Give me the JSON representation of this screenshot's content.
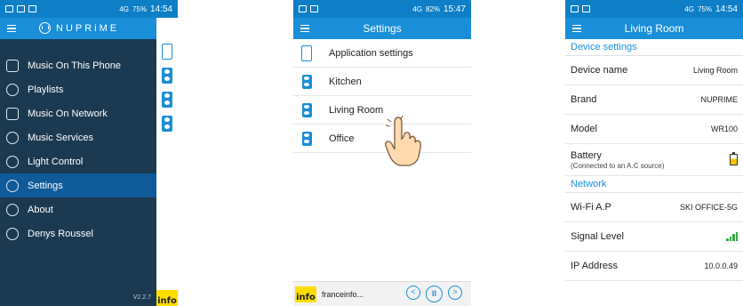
{
  "phone1": {
    "status": {
      "time": "14:54",
      "battery": "75%",
      "network": "4G"
    },
    "brand": "NUPRiME",
    "menu": [
      {
        "label": "Music On This Phone",
        "icon": "phone-music-icon"
      },
      {
        "label": "Playlists",
        "icon": "playlist-icon"
      },
      {
        "label": "Music On Network",
        "icon": "network-drive-icon"
      },
      {
        "label": "Music Services",
        "icon": "cloud-music-icon"
      },
      {
        "label": "Light Control",
        "icon": "lightbulb-icon"
      },
      {
        "label": "Settings",
        "icon": "gear-icon",
        "active": true
      },
      {
        "label": "About",
        "icon": "info-icon"
      },
      {
        "label": "Denys Roussel",
        "icon": "user-icon"
      }
    ],
    "version": "V2.2.7",
    "station_logo": "info"
  },
  "phone2": {
    "status": {
      "time": "15:47",
      "battery": "82%",
      "network": "4G"
    },
    "title": "Settings",
    "rows": [
      {
        "label": "Application settings",
        "icon": "phone-icon"
      },
      {
        "label": "Kitchen",
        "icon": "speaker-icon"
      },
      {
        "label": "Living Room",
        "icon": "speaker-icon"
      },
      {
        "label": "Office",
        "icon": "speaker-icon"
      }
    ],
    "player": {
      "station_logo": "info",
      "track": "franceinfo...",
      "prev": "<",
      "pause": "II",
      "next": ">"
    }
  },
  "phone3": {
    "status": {
      "time": "14:54",
      "battery": "75%",
      "network": "4G"
    },
    "title": "Living Room",
    "device_section": "Device settings",
    "device_name": {
      "label": "Device name",
      "value": "Living Room"
    },
    "brand": {
      "label": "Brand",
      "value": "NUPRIME"
    },
    "model": {
      "label": "Model",
      "value": "WR100"
    },
    "battery": {
      "label": "Battery",
      "sub": "(Connected to an A.C source)"
    },
    "network_section": "Network",
    "wifi": {
      "label": "Wi-Fi A.P",
      "value": "SKI OFFICE-5G"
    },
    "signal": {
      "label": "Signal Level",
      "bars": 4
    },
    "ip": {
      "label": "IP Address",
      "value": "10.0.0.49"
    }
  },
  "colors": {
    "accent": "#1a8fd8",
    "drawer_bg": "#1b3a52",
    "drawer_active": "#0f5a99"
  }
}
